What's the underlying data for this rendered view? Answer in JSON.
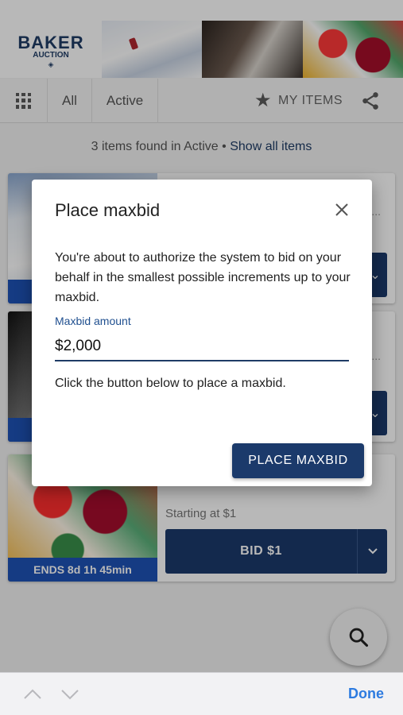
{
  "header": {
    "logo_line1": "BAKER",
    "logo_line2": "AUCTION",
    "logo_mark": "◈"
  },
  "toolbar": {
    "tabs": [
      "All",
      "Active"
    ],
    "my_items_label": "MY ITEMS"
  },
  "results": {
    "found_text": "3 items found in Active",
    "separator": "•",
    "show_all_link": "Show all items"
  },
  "items": [
    {
      "ends": "",
      "starting": "",
      "bid_label": ""
    },
    {
      "ends": "",
      "starting": "",
      "bid_label": ""
    },
    {
      "ends": "ENDS 8d 1h 45min",
      "starting": "Starting at $1",
      "bid_label": "BID $1"
    }
  ],
  "dialog": {
    "title": "Place maxbid",
    "description": "You're about to authorize the system to bid on your behalf in the smallest possible increments up to your maxbid.",
    "field_label": "Maxbid amount",
    "field_value": "$2,000",
    "note": "Click the button below to place a maxbid.",
    "button_label": "PLACE MAXBID"
  },
  "keyboard_bar": {
    "done_label": "Done"
  },
  "colors": {
    "primary": "#1b3a6b",
    "ends_badge": "#1e53b6",
    "link": "#1f3c66",
    "done": "#2d7be0"
  },
  "icons": [
    "grid-icon",
    "star-icon",
    "share-icon",
    "close-icon",
    "chevron-down-icon",
    "search-icon",
    "chevron-up-icon"
  ]
}
